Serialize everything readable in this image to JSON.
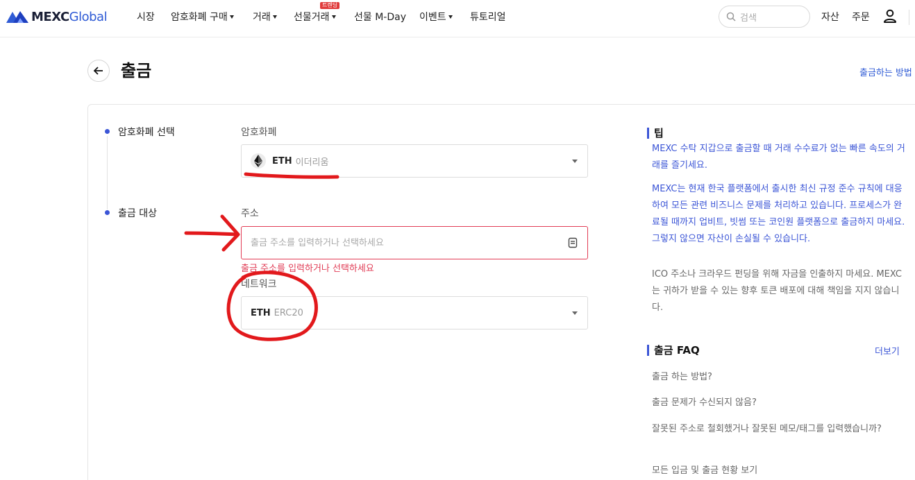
{
  "nav": {
    "logo_main": "MEXC",
    "logo_sub": "Global",
    "items": [
      {
        "label": "시장"
      },
      {
        "label": "암호화폐 구매"
      },
      {
        "label": "거래"
      },
      {
        "label": "선물거래"
      },
      {
        "label": "선물 M-Day"
      },
      {
        "label": "이벤트"
      },
      {
        "label": "튜토리얼"
      }
    ],
    "hot_badge": "트렌딩",
    "search_placeholder": "검색",
    "assets": "자산",
    "orders": "주문",
    "icons": {
      "search": "search-icon",
      "user": "user-icon"
    }
  },
  "header": {
    "title": "출금",
    "how_link": "출금하는 방법",
    "back_icon": "arrow-left-icon"
  },
  "form": {
    "steps": [
      {
        "label": "암호화폐 선택"
      },
      {
        "label": "출금 대상"
      }
    ],
    "crypto": {
      "label": "암호화폐",
      "coin": "ETH",
      "coin_name": "이더리움",
      "icon": "eth-icon"
    },
    "address": {
      "label": "주소",
      "placeholder": "출금 주소를 입력하거나 선택하세요",
      "value": "",
      "error": "출금 주소를 입력하거나 선택하세요",
      "icon": "address-book-icon"
    },
    "network": {
      "label": "네트워크",
      "coin": "ETH",
      "protocol": "ERC20"
    }
  },
  "tips": {
    "title": "팁",
    "items": [
      "MEXC 수탁 지갑으로 출금할 때 거래 수수료가 없는 빠른 속도의 거래를 즐기세요.",
      "MEXC는 현재 한국 플랫폼에서 출시한 최신 규정 준수 규칙에 대응하여 모든 관련 비즈니스 문제를 처리하고 있습니다. 프로세스가 완료될 때까지 업비트, 빗썸 또는 코인원 플랫폼으로 출금하지 마세요. 그렇지 않으면 자산이 손실될 수 있습니다.",
      "ICO 주소나 크라우드 펀딩을 위해 자금을 인출하지 마세요. MEXC는 귀하가 받을 수 있는 향후 토큰 배포에 대해 책임을 지지 않습니다."
    ]
  },
  "faq": {
    "title": "출금 FAQ",
    "more": "더보기",
    "items": [
      "출금 하는 방법?",
      "출금 문제가 수신되지 않음?",
      "잘못된 주소로 철회했거나 잘못된 메모/태그를 입력했습니까?",
      "모든 입금 및 출금 현황 보기"
    ]
  },
  "colors": {
    "accent": "#3b55d6",
    "error": "#e03b54",
    "annotation": "#e2191c"
  }
}
